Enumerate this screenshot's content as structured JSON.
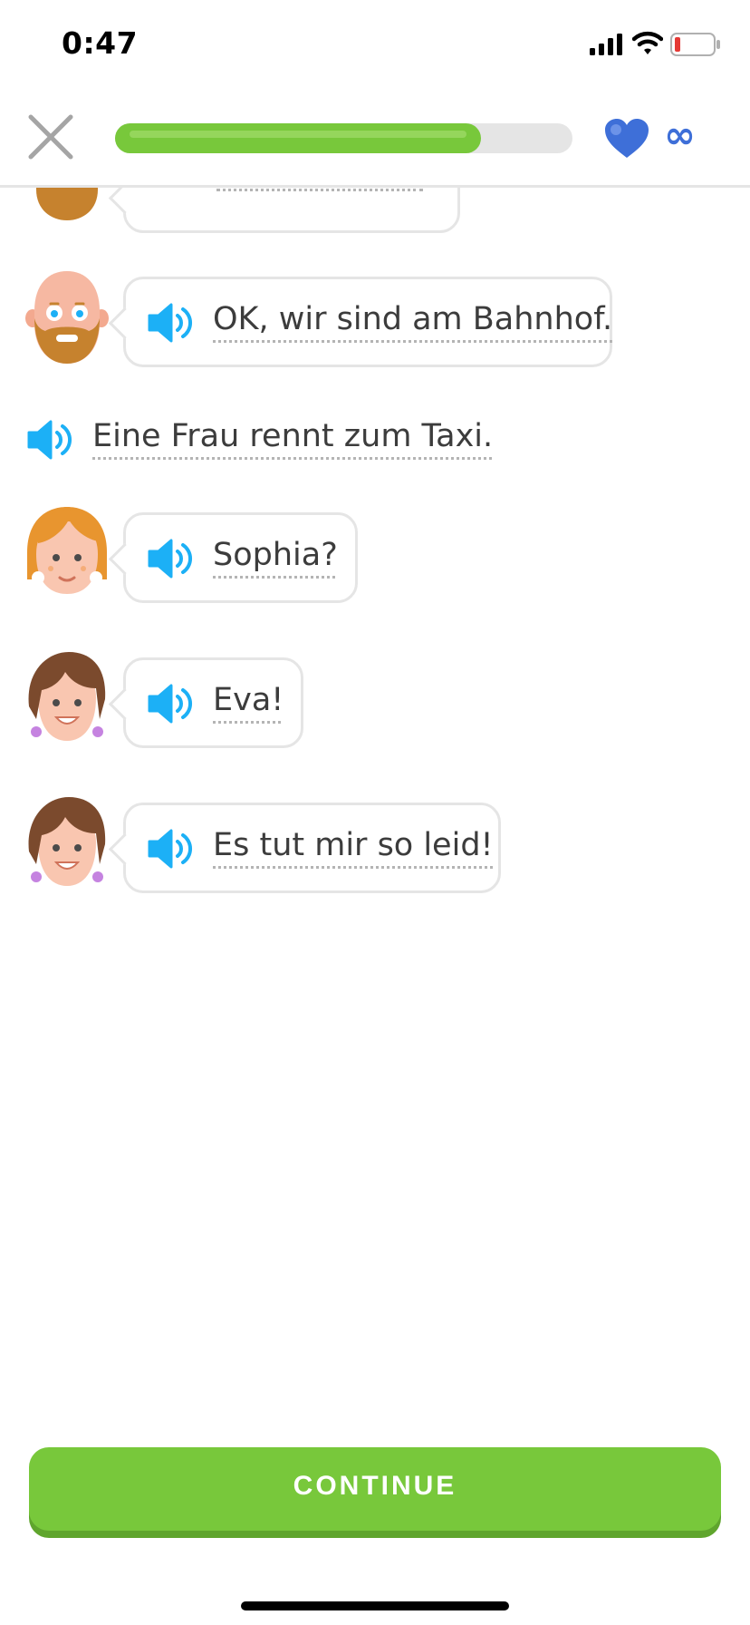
{
  "status_bar": {
    "time": "0:47"
  },
  "header": {
    "progress": 0.8,
    "hearts": "∞"
  },
  "icons": {
    "close": "close-icon",
    "heart": "heart-icon",
    "speaker": "speaker-icon",
    "signal": "signal-icon",
    "wifi": "wifi-icon",
    "battery": "battery-icon"
  },
  "colors": {
    "accent_green": "#78c83b",
    "heart_blue": "#3e6fd8",
    "speaker_blue": "#1cb0f6",
    "bubble_border": "#e5e5e5",
    "battery_low": "#e53935"
  },
  "chat": {
    "messages": [
      {
        "speaker": "bearded-man",
        "text": ""
      },
      {
        "speaker": "bearded-man",
        "text": "OK, wir sind am Bahnhof."
      },
      {
        "speaker": "narrator",
        "text": "Eine Frau rennt zum Taxi."
      },
      {
        "speaker": "orange-hair-woman",
        "text": "Sophia?"
      },
      {
        "speaker": "brown-hair-woman",
        "text": "Eva!"
      },
      {
        "speaker": "brown-hair-woman",
        "text": "Es tut mir so leid!"
      }
    ]
  },
  "footer": {
    "continue_label": "CONTINUE"
  }
}
